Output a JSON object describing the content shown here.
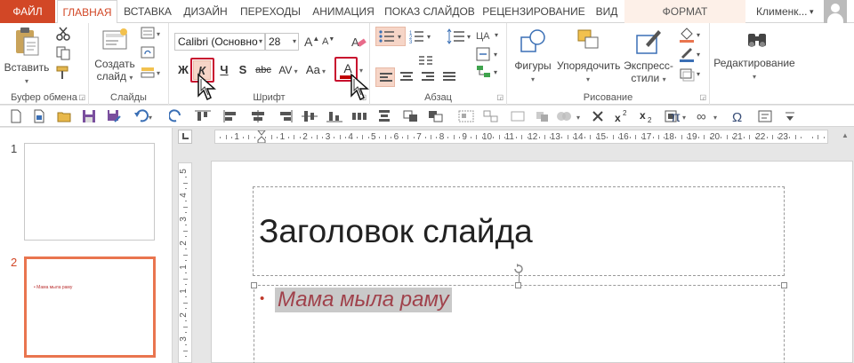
{
  "tabs": {
    "file": "ФАЙЛ",
    "home": "ГЛАВНАЯ",
    "insert": "ВСТАВКА",
    "design": "ДИЗАЙН",
    "transitions": "ПЕРЕХОДЫ",
    "animation": "АНИМАЦИЯ",
    "slideshow": "ПОКАЗ СЛАЙДОВ",
    "review": "РЕЦЕНЗИРОВАНИЕ",
    "view": "ВИД",
    "format": "ФОРМАТ"
  },
  "user": {
    "name": "Клименк...",
    "chevron": "▾"
  },
  "colors": {
    "accent": "#d24726",
    "selection": "#f6d5c7",
    "highlight_box": "#c8102e",
    "font_color": "#c00000",
    "text_red": "#a0424c"
  },
  "ribbon": {
    "clipboard": {
      "label": "Буфер обмена",
      "paste": "Вставить"
    },
    "slides": {
      "label": "Слайды",
      "create_line1": "Создать",
      "create_line2": "слайд"
    },
    "font": {
      "label": "Шрифт",
      "font_name": "Calibri (Основно",
      "font_size": "28",
      "grow": "A",
      "shrink": "A",
      "bold": "Ж",
      "italic": "К",
      "underline": "Ч",
      "shadow": "S",
      "strike": "abc",
      "spacing": "AV",
      "case": "Aa",
      "font_color": "A"
    },
    "paragraph": {
      "label": "Абзац"
    },
    "drawing": {
      "label": "Рисование",
      "shapes": "Фигуры",
      "arrange": "Упорядочить",
      "styles_line1": "Экспресс-",
      "styles_line2": "стили"
    },
    "editing": {
      "label": "Редактирование"
    }
  },
  "ruler": {
    "h_left": [
      "1",
      "2",
      "3",
      "4",
      "5",
      "6",
      "7",
      "8",
      "9",
      "10",
      "11",
      "12"
    ],
    "h_right": [
      "1",
      "2",
      "3",
      "4",
      "5",
      "6",
      "7",
      "8",
      "9",
      "10",
      "11",
      "12",
      "13",
      "14",
      "15",
      "16",
      "17",
      "18",
      "19",
      "20",
      "21",
      "22",
      "23"
    ],
    "v": [
      "5",
      "4",
      "3",
      "2",
      "1",
      "1",
      "2",
      "3"
    ]
  },
  "slides": [
    {
      "number": "1",
      "preview_text": ""
    },
    {
      "number": "2",
      "preview_text": "• Мама мыла раму"
    }
  ],
  "slide": {
    "title": "Заголовок слайда",
    "bullet": "•",
    "body": "Мама мыла раму"
  }
}
